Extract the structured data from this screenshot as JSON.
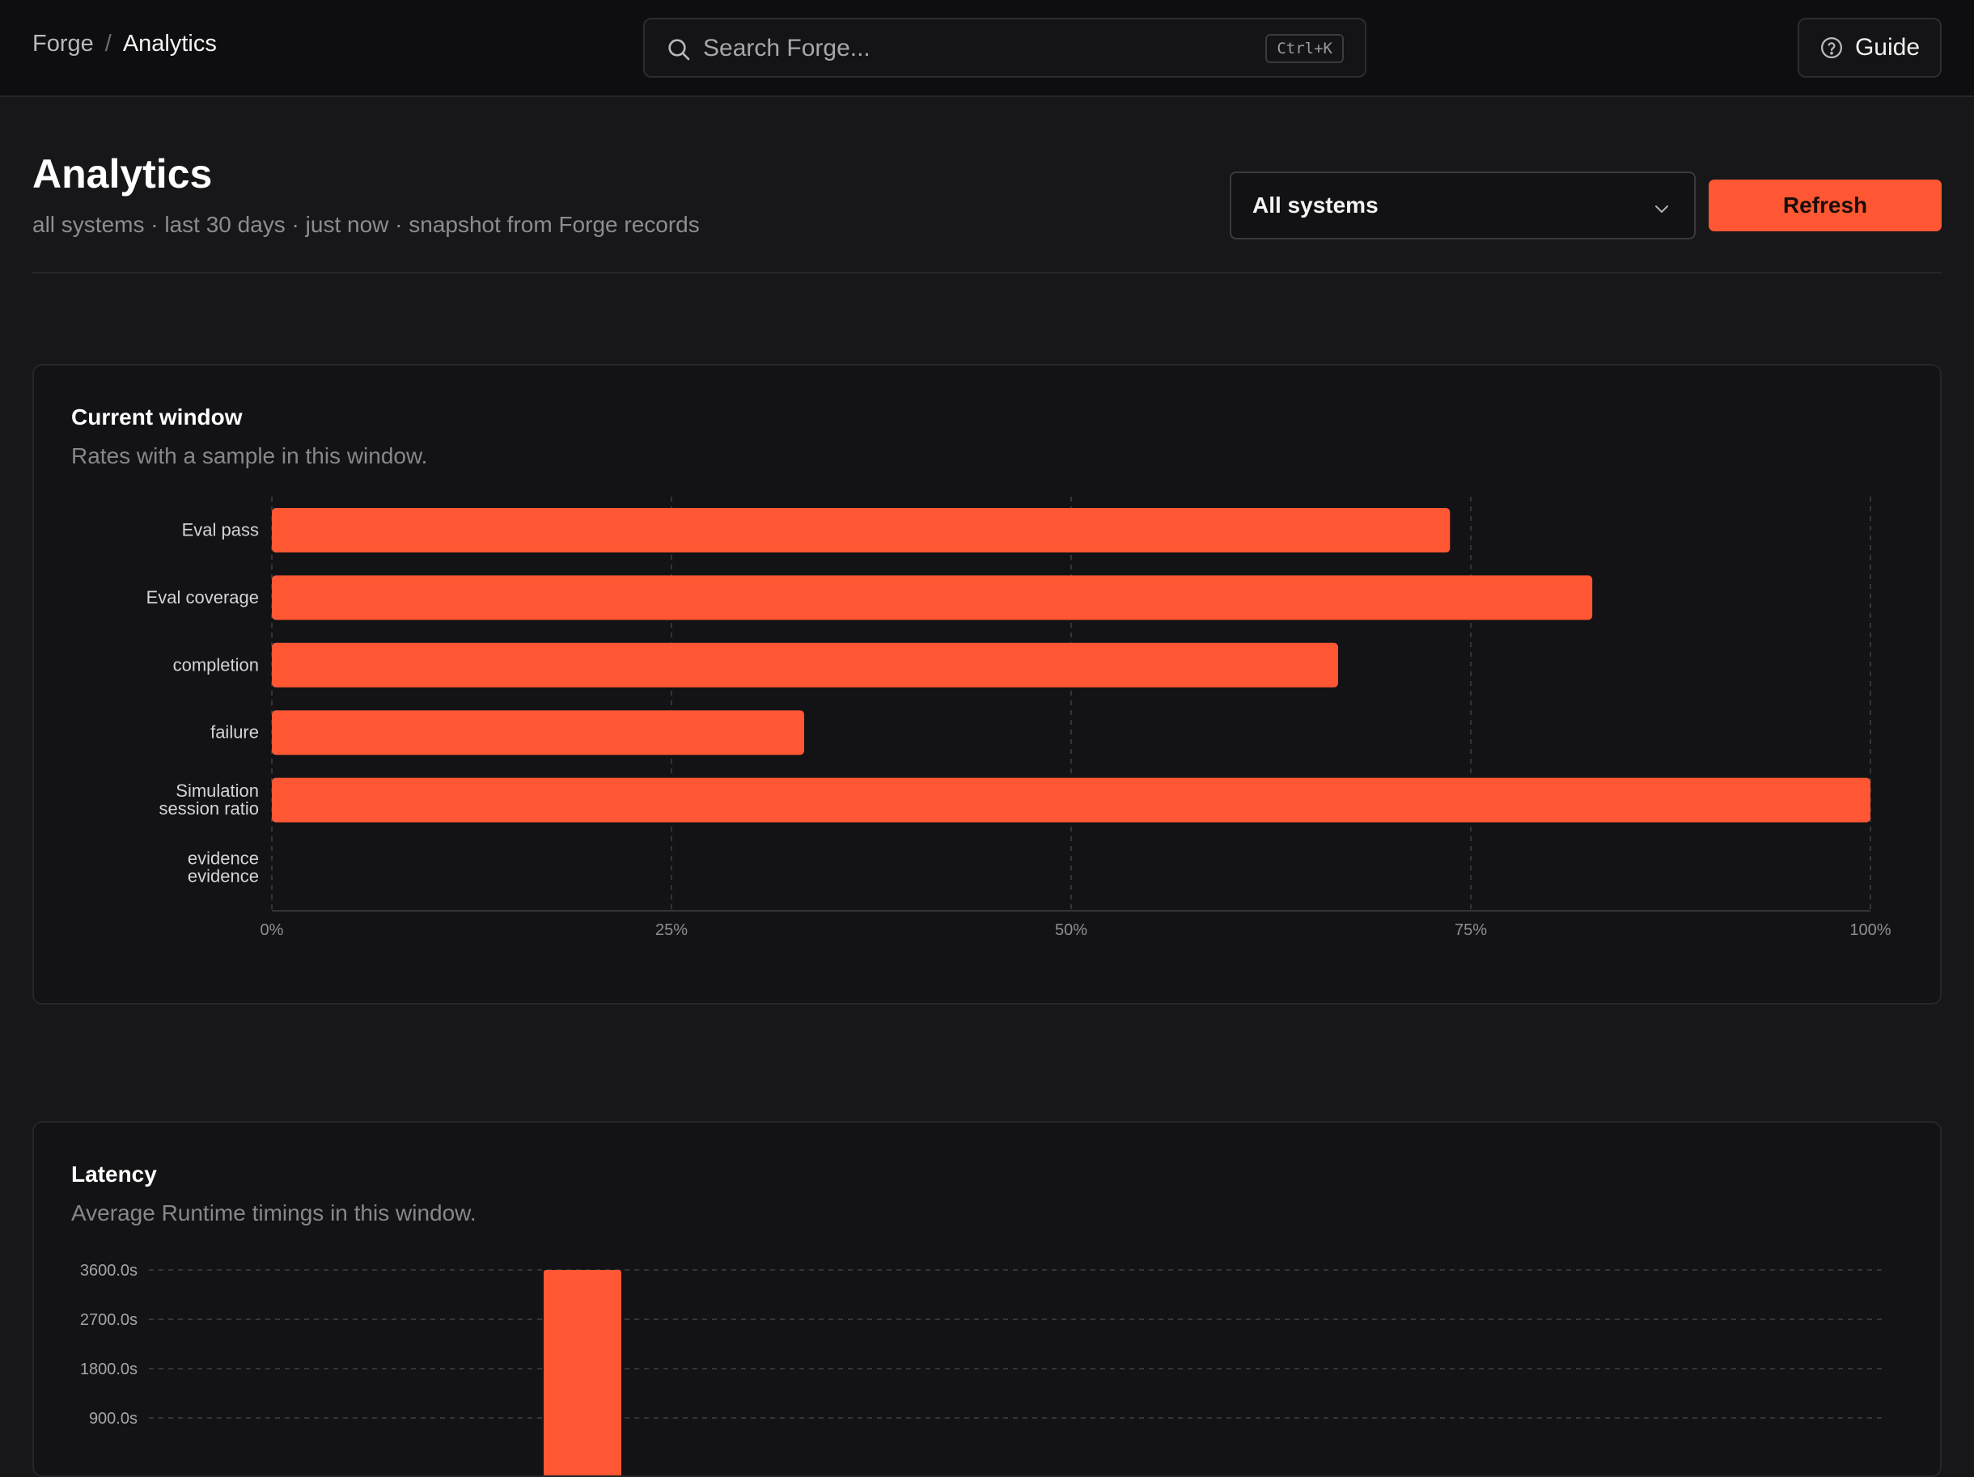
{
  "breadcrumb": {
    "root": "Forge",
    "separator": "/",
    "current": "Analytics"
  },
  "search": {
    "placeholder": "Search Forge...",
    "shortcut": "Ctrl+K"
  },
  "header": {
    "guide_label": "Guide"
  },
  "page": {
    "title": "Analytics",
    "subtitle": "all systems · last 30 days · just now · snapshot from Forge records"
  },
  "controls": {
    "system_select_value": "All systems",
    "refresh_label": "Refresh"
  },
  "colors": {
    "accent": "#ff5733",
    "background": "#17171a",
    "card": "#131316"
  },
  "cards": {
    "current_window": {
      "title": "Current window",
      "subtitle": "Rates with a sample in this window."
    },
    "latency": {
      "title": "Latency",
      "subtitle": "Average Runtime timings in this window."
    }
  },
  "chart_data": [
    {
      "type": "bar",
      "orientation": "horizontal",
      "categories": [
        [
          "Eval pass"
        ],
        [
          "Eval coverage"
        ],
        [
          "completion"
        ],
        [
          "failure"
        ],
        [
          "Simulation",
          "session ratio"
        ],
        [
          "evidence",
          "evidence"
        ]
      ],
      "values": [
        73.7,
        82.6,
        66.7,
        33.3,
        100,
        0
      ],
      "xlim": [
        0,
        100
      ],
      "xticks": [
        "0%",
        "25%",
        "50%",
        "75%",
        "100%"
      ],
      "grid": true
    },
    {
      "type": "bar",
      "yticks": [
        "3600.0s",
        "2700.0s",
        "1800.0s",
        "900.0s"
      ],
      "ylim": [
        0,
        3600
      ],
      "values": [
        3600
      ],
      "grid": true
    }
  ]
}
